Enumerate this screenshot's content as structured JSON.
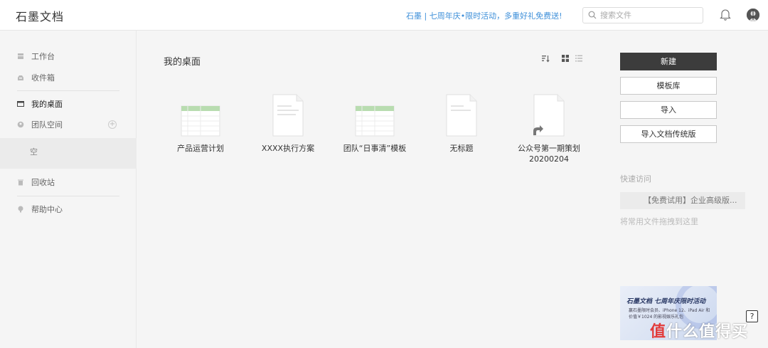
{
  "header": {
    "logo": "石墨文档",
    "promo": "石墨 | 七周年庆•限时活动，多重好礼免费送!",
    "search_placeholder": "搜索文件"
  },
  "sidebar": {
    "items": [
      {
        "label": "工作台",
        "icon": "workbench-icon"
      },
      {
        "label": "收件箱",
        "icon": "inbox-icon"
      },
      {
        "label": "我的桌面",
        "icon": "desktop-icon"
      },
      {
        "label": "团队空间",
        "icon": "team-icon"
      },
      {
        "label": "回收站",
        "icon": "trash-icon"
      },
      {
        "label": "帮助中心",
        "icon": "help-center-icon"
      }
    ],
    "team_empty": "空"
  },
  "main": {
    "title": "我的桌面",
    "files": [
      {
        "name": "产品运营计划",
        "type": "sheet"
      },
      {
        "name": "XXXX执行方案",
        "type": "doc"
      },
      {
        "name": "团队“日事清”模板",
        "type": "sheet"
      },
      {
        "name": "无标题",
        "type": "doc"
      },
      {
        "name": "公众号第一期策划20200204",
        "type": "shortcut"
      }
    ]
  },
  "right": {
    "new_label": "新建",
    "template_label": "模板库",
    "import_label": "导入",
    "import_legacy_label": "导入文档传统版",
    "quick_title": "快速访问",
    "quick_item": "【免费试用】企业高级版...",
    "quick_hint": "将常用文件拖拽到这里"
  },
  "banner": {
    "title": "石墨文档 七周年庆限时活动",
    "desc": "赢石墨限时会员、iPhone 12、iPad Air 和价值￥1024 的影视娱乐礼包"
  },
  "watermark": {
    "badge": "值",
    "text": "什么值得买"
  },
  "colors": {
    "accent": "#3d8fd9",
    "primary_button": "#3c3c3c",
    "sheet_green": "#b8dcb0"
  }
}
